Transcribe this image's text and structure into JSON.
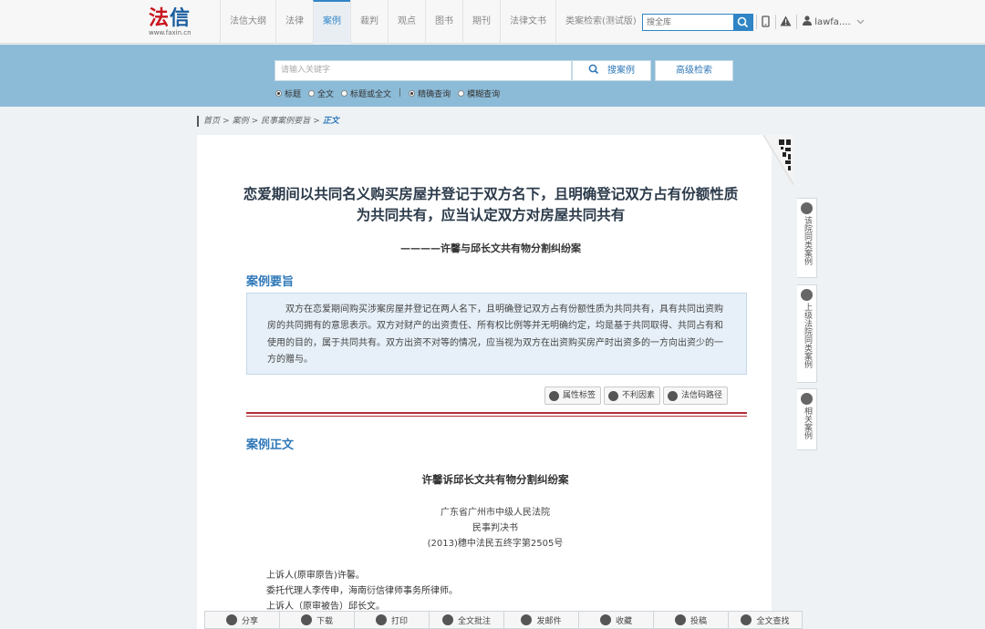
{
  "brand": {
    "logo_fa": "法",
    "logo_xin": "信",
    "url": "www.faxin.cn"
  },
  "nav": {
    "items": [
      "法信大纲",
      "法律",
      "案例",
      "裁判",
      "观点",
      "图书",
      "期刊",
      "法律文书",
      "类案检索(测试版)"
    ],
    "active": "案例"
  },
  "top_search": {
    "placeholder": "搜全库"
  },
  "user": {
    "name": "lawfa...."
  },
  "case_search": {
    "placeholder": "请输入关键字",
    "search_label": "搜案例",
    "advanced_label": "高级检索",
    "scope_options": [
      "标题",
      "全文",
      "标题或全文"
    ],
    "scope_selected": "标题",
    "mode_options": [
      "精确查询",
      "模糊查询"
    ],
    "mode_selected": "精确查询",
    "separator": "|"
  },
  "breadcrumb": {
    "items": [
      "首页",
      "案例",
      "民事案例要旨"
    ],
    "current": "正文",
    "sep": ">"
  },
  "article": {
    "title_line1": "恋爱期间以共同名义购买房屋并登记于双方名下，且明确登记双方占有份额性质",
    "title_line2": "为共同共有，应当认定双方对房屋共同共有",
    "subtitle": "————许馨与邱长文共有物分割纠纷案",
    "summary_heading": "案例要旨",
    "summary": "双方在恋爱期间购买涉案房屋并登记在两人名下，且明确登记双方占有份额性质为共同共有，具有共同出资购房的共同拥有的意思表示。双方对财产的出资责任、所有权比例等并无明确约定，均是基于共同取得、共同占有和使用的目的，属于共同共有。双方出资不对等的情况，应当视为双方在出资购买房产时出资多的一方向出资少的一方的赠与。",
    "tags": [
      "属性标签",
      "不利因素",
      "法信码路径"
    ],
    "body_heading": "案例正文",
    "doc_title": "许馨诉邱长文共有物分割纠纷案",
    "court": "广东省广州市中级人民法院",
    "doc_type": "民事判决书",
    "case_no": "(2013)穗中法民五终字第2505号",
    "paragraphs": [
      "上诉人(原审原告)许馨。",
      "委托代理人李传申，海南衍信律师事务所律师。",
      "上诉人（原审被告）邱长文。"
    ]
  },
  "side_tabs": [
    "该院同类案例",
    "上级法院同类案例",
    "相关案例"
  ],
  "bottom_toolbar": [
    "分享",
    "下载",
    "打印",
    "全文批注",
    "发邮件",
    "收藏",
    "投稿",
    "全文查找"
  ],
  "colors": {
    "accent": "#2f78b8",
    "band": "#8cbbd7",
    "brand_red": "#c9151e",
    "divider": "#b42e35"
  }
}
